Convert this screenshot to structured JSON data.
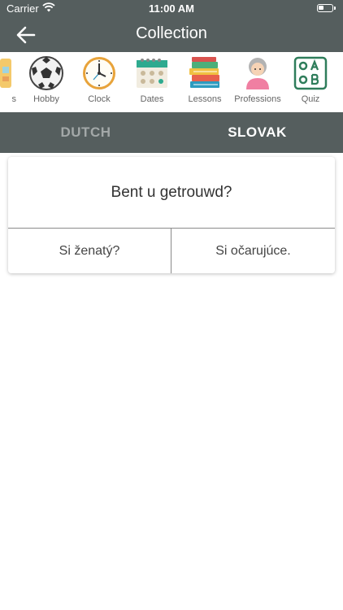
{
  "status_bar": {
    "carrier": "Carrier",
    "time": "11:00 AM"
  },
  "nav": {
    "title": "Collection",
    "back_icon": "arrow-left-icon"
  },
  "categories": [
    {
      "label": "s",
      "icon": "partial-icon"
    },
    {
      "label": "Hobby",
      "icon": "soccer-ball-icon"
    },
    {
      "label": "Clock",
      "icon": "clock-icon"
    },
    {
      "label": "Dates",
      "icon": "calendar-icon"
    },
    {
      "label": "Lessons",
      "icon": "books-icon"
    },
    {
      "label": "Professions",
      "icon": "person-icon"
    },
    {
      "label": "Quiz",
      "icon": "quiz-abc-icon"
    }
  ],
  "tabs": [
    {
      "label": "DUTCH",
      "active": false
    },
    {
      "label": "SLOVAK",
      "active": true
    }
  ],
  "quiz": {
    "question": "Bent u getrouwd?",
    "answers": [
      "Si ženatý?",
      "Si očarujúce."
    ]
  },
  "colors": {
    "header": "#555e5e",
    "tab_inactive": "#a3a8a8",
    "tab_active": "#ffffff"
  }
}
